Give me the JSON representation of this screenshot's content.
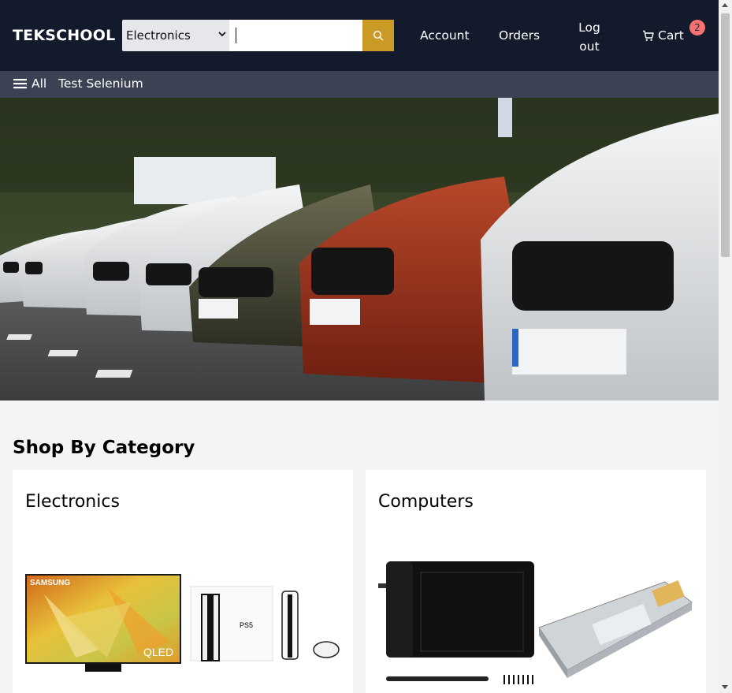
{
  "header": {
    "logo": "TEKSCHOOL",
    "search": {
      "category_selected": "Electronics",
      "query_value": "",
      "search_icon": "search-icon"
    },
    "nav": {
      "account": "Account",
      "orders": "Orders",
      "logout": "Log out",
      "cart": "Cart",
      "cart_count": "2"
    }
  },
  "subnav": {
    "all_label": "All",
    "link": "Test Selenium"
  },
  "hero": {
    "image": "bmw-cars-parked-row"
  },
  "shop_by_category": {
    "title": "Shop By Category",
    "cards": [
      {
        "title": "Electronics",
        "products": [
          "samsung-qled-tv",
          "ps5-console"
        ],
        "tv_brand": "SAMSUNG",
        "tv_badge": "QLED",
        "ps_logo": "PS5"
      },
      {
        "title": "Computers",
        "products": [
          "drawing-tablet",
          "sfp-module"
        ]
      }
    ]
  },
  "colors": {
    "header_bg": "#131a2c",
    "subnav_bg": "#3a4254",
    "search_button": "#c99a26",
    "cart_badge": "#f87171",
    "page_bg": "#f3f4f6"
  }
}
